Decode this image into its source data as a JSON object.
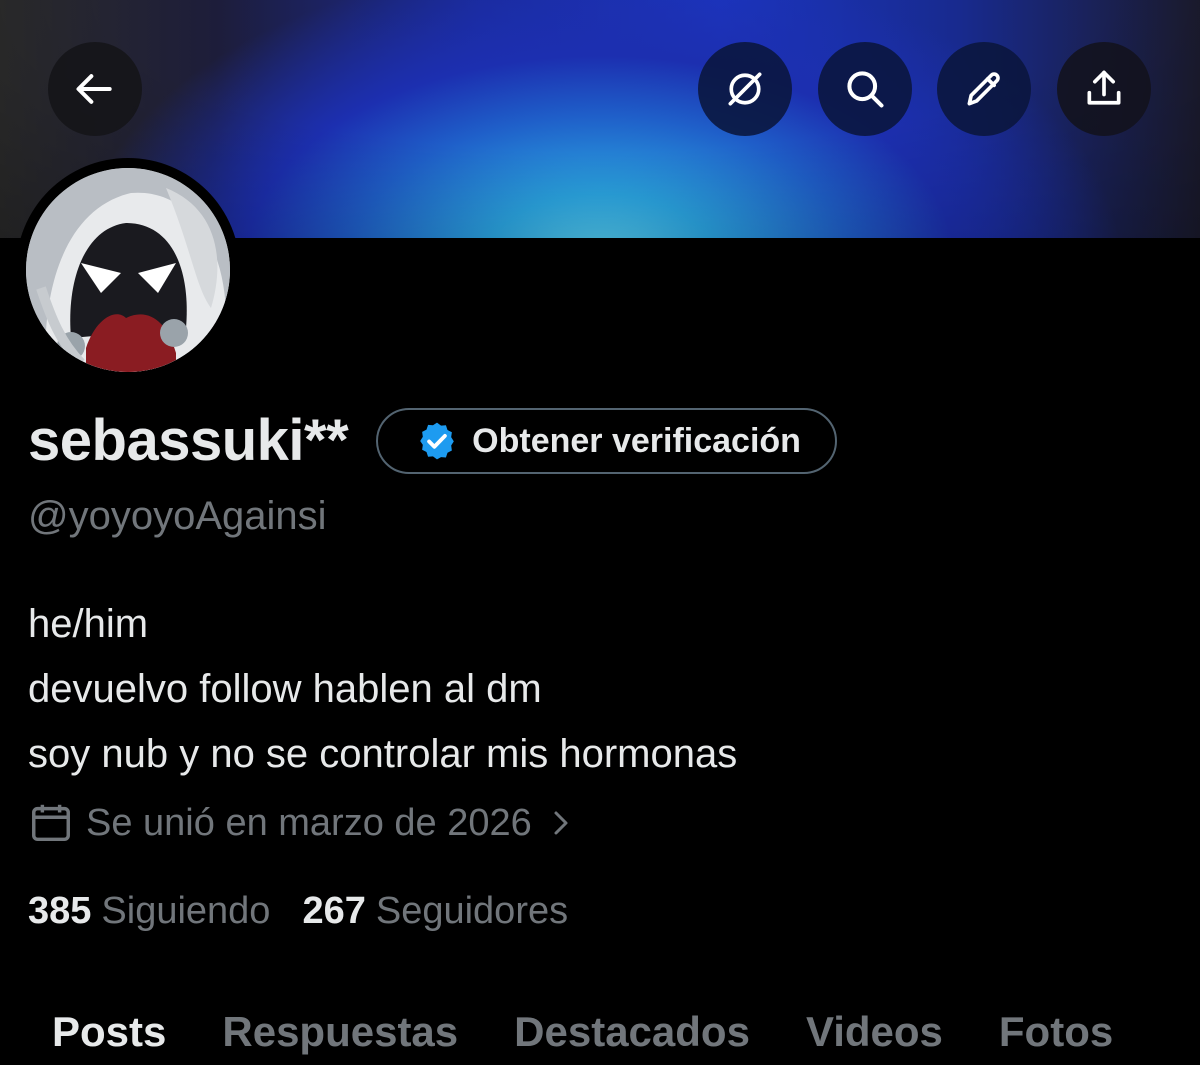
{
  "header": {
    "back_icon": "arrow-left-icon",
    "grok_icon": "grok-icon",
    "search_icon": "search-icon",
    "edit_icon": "pencil-icon",
    "share_icon": "share-icon"
  },
  "profile": {
    "display_name": "sebassuki**",
    "verify_button_label": "Obtener verificación",
    "verify_badge_color": "#1d9bf0",
    "handle": "@yoyoyoAgainsi",
    "bio_lines": [
      "he/him",
      "devuelvo follow hablen al dm",
      "soy nub y no se controlar mis hormonas"
    ],
    "joined": "Se unió en marzo de 2026",
    "following_count": "385",
    "following_label": "Siguiendo",
    "followers_count": "267",
    "followers_label": "Seguidores"
  },
  "tabs": [
    {
      "label": "Posts",
      "active": true
    },
    {
      "label": "Respuestas",
      "active": false
    },
    {
      "label": "Destacados",
      "active": false
    },
    {
      "label": "Videos",
      "active": false
    },
    {
      "label": "Fotos",
      "active": false
    }
  ],
  "colors": {
    "background": "#000000",
    "primary_text": "#e7e9ea",
    "secondary_text": "#71767b",
    "accent": "#1d9bf0"
  }
}
